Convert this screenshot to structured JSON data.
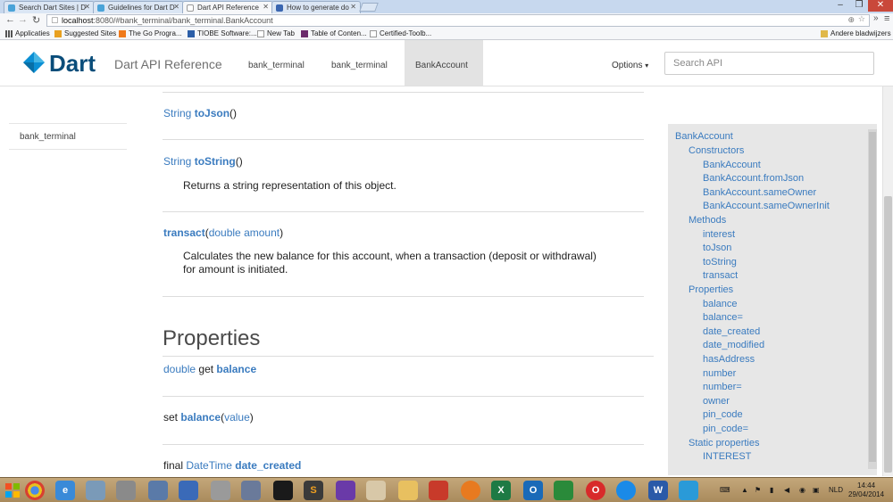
{
  "browser": {
    "tabs": [
      {
        "label": "Search Dart Sites | D"
      },
      {
        "label": "Guidelines for Dart D"
      },
      {
        "label": "Dart API Reference"
      },
      {
        "label": "How to generate do"
      }
    ],
    "window_controls": {
      "minimize": "–",
      "restore": "❐",
      "close": "✕"
    },
    "url_host": "localhost",
    "url_rest": ":8080/#bank_terminal/bank_terminal.BankAccount",
    "bookmarks": [
      {
        "label": "Applicaties",
        "icon": "apps-grid-icon"
      },
      {
        "label": "Suggested Sites",
        "icon": "ie-icon"
      },
      {
        "label": "The Go Progra...",
        "icon": "blogger-icon"
      },
      {
        "label": "TIOBE Software:...",
        "icon": "tiobe-icon"
      },
      {
        "label": "New Tab",
        "icon": "page-icon"
      },
      {
        "label": "Table of Conten...",
        "icon": "book-icon"
      },
      {
        "label": "Certified-Toolb...",
        "icon": "page-icon"
      }
    ],
    "other_bookmarks": "Andere bladwijzers"
  },
  "header": {
    "logo_text": "Dart",
    "title": "Dart API Reference",
    "breadcrumbs": [
      "bank_terminal",
      "bank_terminal",
      "BankAccount"
    ],
    "options_label": "Options",
    "options_caret": "▾",
    "search_placeholder": "Search API"
  },
  "leftnav": {
    "item": "bank_terminal"
  },
  "methods": [
    {
      "type": "String",
      "name": "toJson",
      "params": "()"
    },
    {
      "type": "String",
      "name": "toString",
      "params": "()",
      "desc": "Returns a string representation of this object."
    },
    {
      "name": "transact",
      "open": "(",
      "param_type": "double",
      "param_name": "amount",
      "close": ")",
      "desc1": "Calculates the new balance for this account, when a transaction (deposit or withdrawal)",
      "desc2": "for amount is initiated."
    }
  ],
  "properties": {
    "title": "Properties",
    "items": [
      {
        "type": "double",
        "kw": "get",
        "name": "balance"
      },
      {
        "kw": "set",
        "name": "balance",
        "open": "(",
        "param": "value",
        "close": ")"
      },
      {
        "kw": "final",
        "type": "DateTime",
        "name": "date_created"
      }
    ]
  },
  "toc": {
    "class": "BankAccount",
    "constructors_label": "Constructors",
    "constructors": [
      "BankAccount",
      "BankAccount.fromJson",
      "BankAccount.sameOwner",
      "BankAccount.sameOwnerInit"
    ],
    "methods_label": "Methods",
    "methods": [
      "interest",
      "toJson",
      "toString",
      "transact"
    ],
    "properties_label": "Properties",
    "properties": [
      "balance",
      "balance=",
      "date_created",
      "date_modified",
      "hasAddress",
      "number",
      "number=",
      "owner",
      "pin_code",
      "pin_code="
    ],
    "static_label": "Static properties",
    "static": [
      "INTEREST"
    ]
  },
  "taskbar": {
    "lang": "NLD",
    "time": "14:44",
    "date": "29/04/2014"
  }
}
